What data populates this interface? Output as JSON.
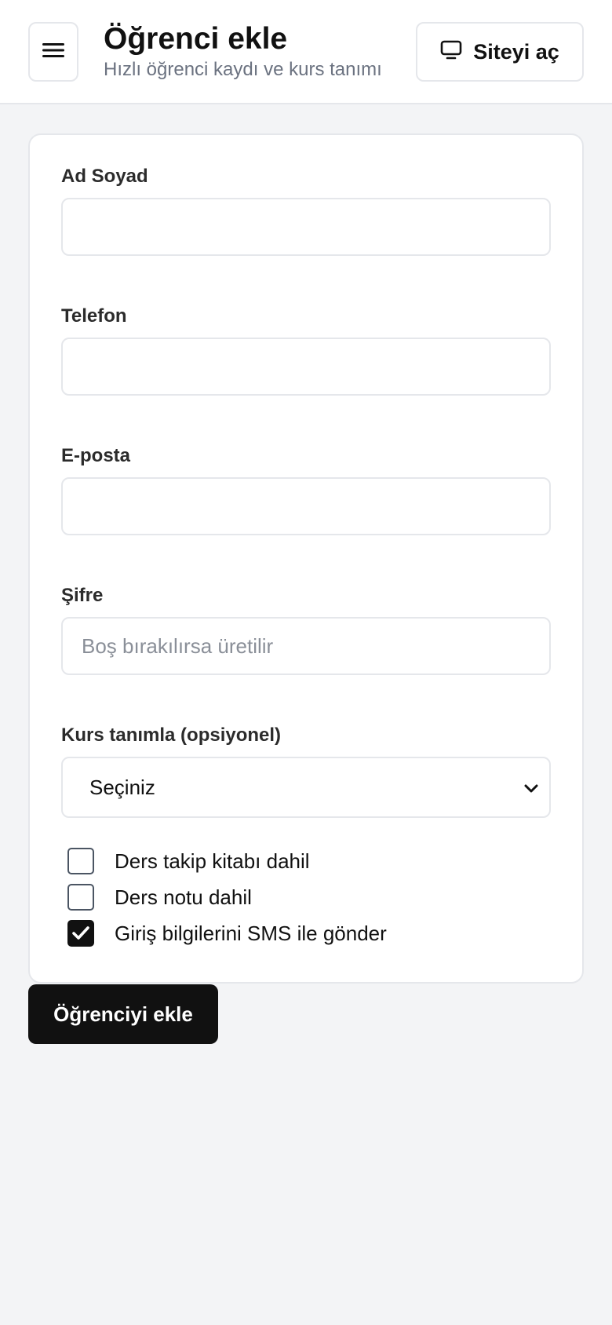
{
  "header": {
    "title": "Öğrenci ekle",
    "subtitle": "Hızlı öğrenci kaydı ve kurs tanımı",
    "menu_icon": "hamburger-menu-icon",
    "site_button": {
      "label": "Siteyi aç",
      "icon": "monitor-icon"
    }
  },
  "form": {
    "fields": [
      {
        "label": "Ad Soyad",
        "value": "",
        "placeholder": ""
      },
      {
        "label": "Telefon",
        "value": "",
        "placeholder": ""
      },
      {
        "label": "E-posta",
        "value": "",
        "placeholder": ""
      },
      {
        "label": "Şifre",
        "value": "",
        "placeholder": "Boş bırakılırsa üretilir"
      }
    ],
    "course": {
      "label": "Kurs tanımla (opsiyonel)",
      "selected": "Seçiniz",
      "icon": "chevron-down-icon"
    },
    "options": [
      {
        "label": "Ders takip kitabı dahil",
        "checked": false
      },
      {
        "label": "Ders notu dahil",
        "checked": false
      },
      {
        "label": "Giriş bilgilerini SMS ile gönder",
        "checked": true
      }
    ],
    "submit_label": "Öğrenciyi ekle"
  },
  "colors": {
    "background": "#f3f4f6",
    "card": "#ffffff",
    "border": "#e5e7eb",
    "primary_button": "#111111",
    "subtitle": "#6b7280"
  }
}
